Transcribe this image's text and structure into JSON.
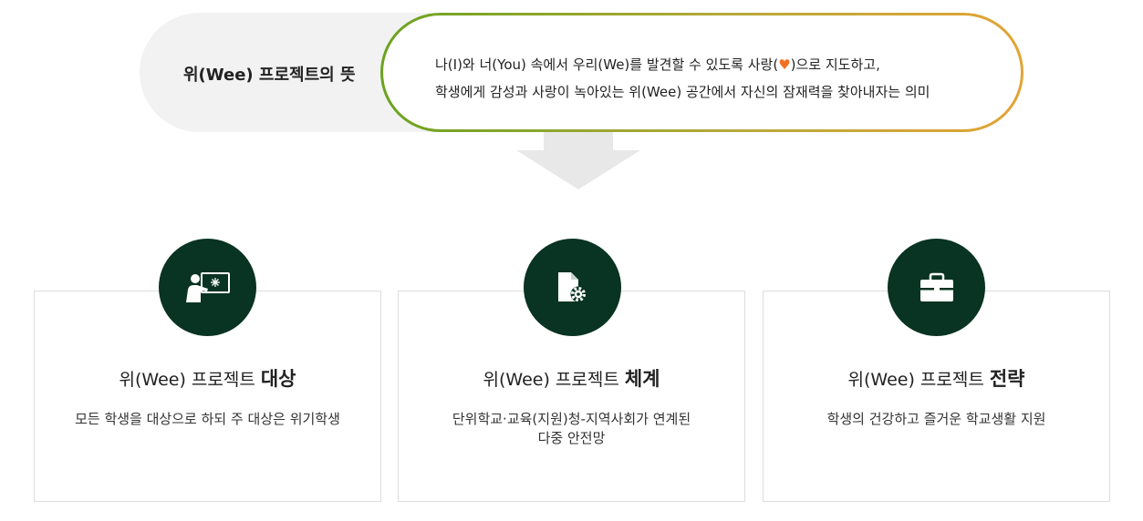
{
  "meaning": {
    "title": "위(Wee) 프로젝트의 뜻",
    "line1_before": "나(I)와 너(You) 속에서 우리(We)를 발견할 수 있도록 사랑(",
    "line1_heart": "♥",
    "line1_after": ")으로 지도하고,",
    "line2": "학생에게 감성과 사랑이 녹아있는 위(Wee) 공간에서 자신의 잠재력을 찾아내자는 의미"
  },
  "colors": {
    "circle_bg": "#093322",
    "heart": "#f36f21",
    "gradient_start": "#6aa31f",
    "gradient_end": "#e3a435",
    "arrow": "#e8e8e8"
  },
  "cards": [
    {
      "icon": "teacher-board-icon",
      "title_prefix": "위(Wee) 프로젝트 ",
      "title_emphasis": "대상",
      "desc_line1": "모든 학생을 대상으로 하되 주 대상은 위기학생",
      "desc_line2": ""
    },
    {
      "icon": "document-gear-icon",
      "title_prefix": "위(Wee) 프로젝트 ",
      "title_emphasis": "체계",
      "desc_line1": "단위학교·교육(지원)청-지역사회가 연계된",
      "desc_line2": "다중 안전망"
    },
    {
      "icon": "briefcase-icon",
      "title_prefix": "위(Wee) 프로젝트 ",
      "title_emphasis": "전략",
      "desc_line1": "학생의 건강하고 즐거운 학교생활 지원",
      "desc_line2": ""
    }
  ]
}
